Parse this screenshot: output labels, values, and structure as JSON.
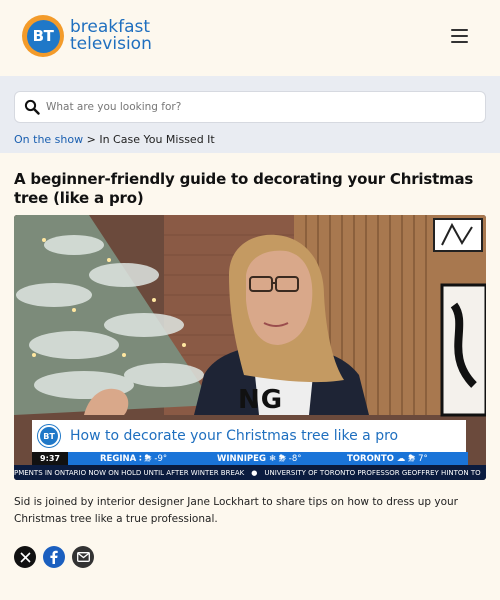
{
  "header": {
    "logo_badge": "BT",
    "logo_line1": "breakfast",
    "logo_line2": "television",
    "menu_icon": "hamburger-menu-icon",
    "brand_color": "#1f6fbf",
    "badge_ring_color": "#f39b2a"
  },
  "search": {
    "placeholder": "What are you looking for?",
    "icon": "search-icon"
  },
  "breadcrumb": {
    "link": "On the show",
    "separator": ">",
    "current": "In Case You Missed It"
  },
  "article": {
    "title": "A beginner-friendly guide to decorating your Christmas tree (like a pro)",
    "description": "Sid is joined by interior designer Jane Lockhart to share tips on how to dress up your Christmas tree like a true professional."
  },
  "video": {
    "lower_third_badge": "BT",
    "lower_third_title": "How to decorate your Christmas tree like a pro",
    "shirt_text": "NG",
    "time": "9:37",
    "weather": [
      {
        "city": "REGINA",
        "icon": "snow-icon",
        "temp": "-9°"
      },
      {
        "city": "WINNIPEG",
        "icon": "snowflake-icon",
        "temp": "-8°"
      },
      {
        "city": "TORONTO",
        "icon": "cloud-icon",
        "temp": "7°"
      }
    ],
    "ticker": [
      "PMENTS IN ONTARIO NOW ON HOLD UNTIL AFTER WINTER BREAK",
      "UNIVERSITY OF TORONTO PROFESSOR GEOFFREY HINTON TO"
    ]
  },
  "share": {
    "x": "x-icon",
    "facebook": "facebook-icon",
    "email": "email-icon"
  }
}
